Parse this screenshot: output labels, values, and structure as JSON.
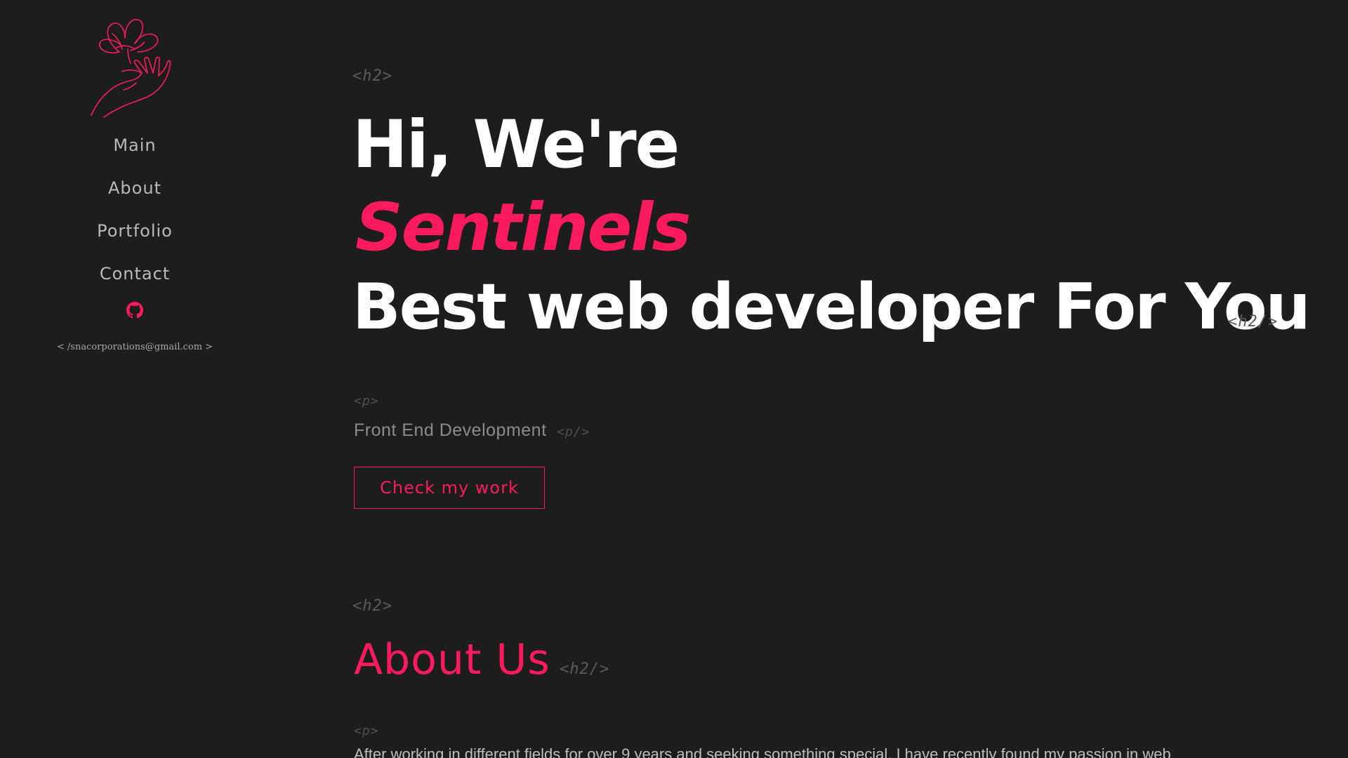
{
  "sidebar": {
    "nav": {
      "main": "Main",
      "about": "About",
      "portfolio": "Portfolio",
      "contact": "Contact"
    },
    "email": "< /snacorporations@gmail.com >",
    "logo_icon": "flower-in-hand-logo",
    "github_icon": "github-icon"
  },
  "hero": {
    "tag_open": "<h2>",
    "line1": "Hi, We're",
    "line2": "Sentinels",
    "line3": "Best web developer For You",
    "tag_close": "<h2/>",
    "p_open": "<p>",
    "subtitle": "Front End Development",
    "p_close": "<p/>",
    "cta_label": "Check my work"
  },
  "about": {
    "tag_open": "<h2>",
    "title": "About Us",
    "tag_close": "<h2/>",
    "p_open": "<p>",
    "text": "After working in different fields for over 9 years and seeking something special, I have recently found my passion in web"
  },
  "colors": {
    "background": "#1d1d1d",
    "accent": "#fb1a5e",
    "heading": "#ffffff",
    "nav_text": "#b9b9b9",
    "tag_text": "#5a5a5a"
  }
}
